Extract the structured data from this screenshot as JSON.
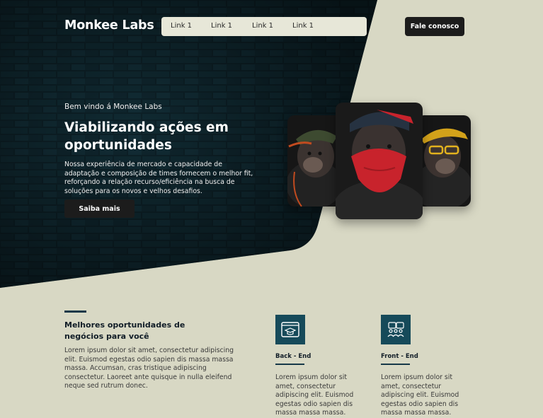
{
  "header": {
    "logo": "Monkee Labs",
    "nav_links": [
      "Link 1",
      "Link 1",
      "Link 1",
      "Link 1"
    ],
    "contact_label": "Fale conosco"
  },
  "hero": {
    "welcome": "Bem vindo á Monkee Labs",
    "title": "Viabilizando ações em oportunidades",
    "description": "Nossa experiência de mercado e capacidade de adaptação e composição de times fornecem o melhor fit, reforçando a relação recurso/eficiência na busca de soluções para os novos e velhos desafios.",
    "cta_label": "Saiba mais"
  },
  "section": {
    "title": "Melhores oportunidades de negócios para você",
    "description": "Lorem ipsum dolor sit amet, consectetur adipiscing elit. Euismod egestas odio sapien dis massa massa massa. Accumsan, cras tristique adipiscing consectetur. Laoreet ante quisque in nulla eleifend neque sed rutrum donec."
  },
  "features": [
    {
      "label": "Back - End",
      "icon": "graduation-window-icon",
      "description": "Lorem ipsum dolor sit amet, consectetur adipiscing elit. Euismod egestas odio sapien dis massa massa massa."
    },
    {
      "label": "Front - End",
      "icon": "team-people-icon",
      "description": "Lorem ipsum dolor sit amet, consectetur adipiscing elit. Euismod egestas odio sapien dis massa massa massa."
    }
  ],
  "colors": {
    "page_background": "#d8d8c4",
    "hero_dark": "#0b1c22",
    "accent": "#164a5a",
    "button_dark": "#1c1c1c"
  }
}
